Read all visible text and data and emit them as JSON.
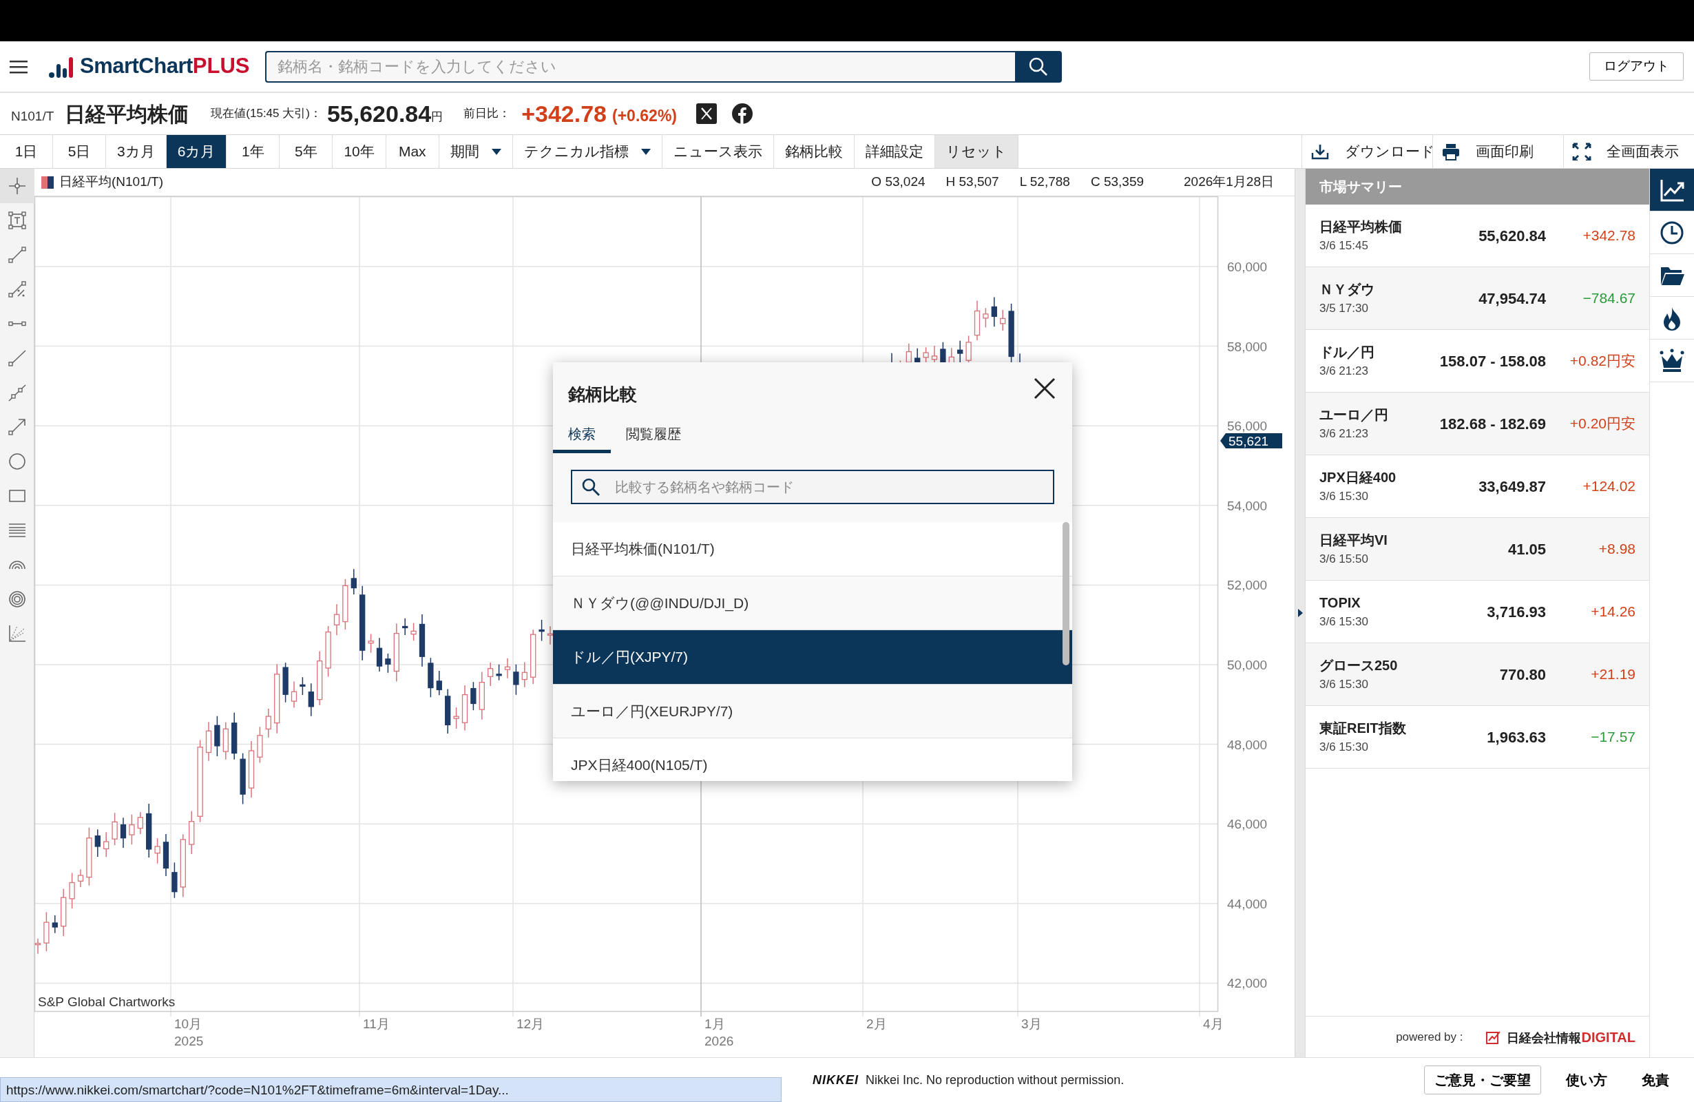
{
  "header": {
    "logo": {
      "main": "SmartChart",
      "accent": "PLUS"
    },
    "search": {
      "placeholder": "銘柄名・銘柄コードを入力してください"
    },
    "logout": "ログアウト"
  },
  "quote": {
    "code": "N101/T",
    "name": "日経平均株価",
    "price_label": "現在値(15:45 大引)：",
    "price": "55,620.84",
    "unit": "円",
    "change_label": "前日比：",
    "change": "+342.78",
    "change_pct": "(+0.62%)"
  },
  "toolbar": {
    "periods": [
      {
        "label": "1日",
        "selected": false
      },
      {
        "label": "5日",
        "selected": false
      },
      {
        "label": "3カ月",
        "selected": false
      },
      {
        "label": "6カ月",
        "selected": true
      },
      {
        "label": "1年",
        "selected": false
      },
      {
        "label": "5年",
        "selected": false
      },
      {
        "label": "10年",
        "selected": false
      },
      {
        "label": "Max",
        "selected": false
      }
    ],
    "menus": [
      {
        "label": "期間",
        "kind": "dropdown"
      },
      {
        "label": "テクニカル指標",
        "kind": "dropdown"
      },
      {
        "label": "ニュース表示",
        "kind": "plain"
      },
      {
        "label": "銘柄比較",
        "kind": "plain"
      },
      {
        "label": "詳細設定",
        "kind": "plain"
      },
      {
        "label": "リセット",
        "kind": "reset"
      }
    ],
    "actions": [
      {
        "label": "ダウンロード",
        "kind": "download"
      },
      {
        "label": "画面印刷",
        "kind": "print"
      },
      {
        "label": "全画面表示",
        "kind": "fullscreen"
      }
    ]
  },
  "drawing_tools": [
    {
      "kind": "crosshair",
      "selected": true
    },
    {
      "kind": "textbox",
      "selected": false
    },
    {
      "kind": "segment",
      "selected": false
    },
    {
      "kind": "percent",
      "selected": false
    },
    {
      "kind": "hsegment",
      "selected": false
    },
    {
      "kind": "ray",
      "selected": false
    },
    {
      "kind": "polyline",
      "selected": false
    },
    {
      "kind": "arrow",
      "selected": false
    },
    {
      "kind": "circle",
      "selected": false
    },
    {
      "kind": "rect",
      "selected": false
    },
    {
      "kind": "lines",
      "selected": false
    },
    {
      "kind": "arcs",
      "selected": false
    },
    {
      "kind": "rings",
      "selected": false
    },
    {
      "kind": "fan",
      "selected": false
    }
  ],
  "chart": {
    "legend": "日経平均(N101/T)",
    "ohlc": [
      "O 53,024",
      "H 53,507",
      "L 52,788",
      "C 53,359"
    ],
    "date": "2026年1月28日",
    "y_labels": [
      "60,000",
      "58,000",
      "56,000",
      "54,000",
      "52,000",
      "50,000",
      "48,000",
      "46,000",
      "44,000",
      "42,000"
    ],
    "price_tag": "55,621",
    "x_labels": [
      {
        "month": "10月",
        "year": "2025"
      },
      {
        "month": "11月"
      },
      {
        "month": "12月"
      },
      {
        "month": "1月",
        "year": "2026"
      },
      {
        "month": "2月"
      },
      {
        "month": "3月"
      },
      {
        "month": "4月"
      }
    ],
    "credit": "S&P Global Chartworks"
  },
  "compare_dialog": {
    "title": "銘柄比較",
    "tabs": [
      {
        "label": "検索",
        "selected": true
      },
      {
        "label": "閲覧履歴",
        "selected": false
      }
    ],
    "search": {
      "placeholder": "比較する銘柄名や銘柄コード"
    },
    "results": [
      {
        "label": "日経平均株価(N101/T)",
        "selected": false
      },
      {
        "label": "ＮＹダウ(@@INDU/DJI_D)",
        "selected": false
      },
      {
        "label": "ドル／円(XJPY/7)",
        "selected": true
      },
      {
        "label": "ユーロ／円(XEURJPY/7)",
        "selected": false
      },
      {
        "label": "JPX日経400(N105/T)",
        "selected": false
      }
    ]
  },
  "market_summary": {
    "title": "市場サマリー",
    "rows": [
      {
        "name": "日経平均株価",
        "time": "3/6 15:45",
        "value": "55,620.84",
        "change": "+342.78",
        "color": "#d2401a"
      },
      {
        "name": "ＮＹダウ",
        "time": "3/5 17:30",
        "value": "47,954.74",
        "change": "−784.67",
        "color": "#2a9a3a"
      },
      {
        "name": "ドル／円",
        "time": "3/6 21:23",
        "value": "158.07 - 158.08",
        "change": "+0.82円安",
        "color": "#d2401a"
      },
      {
        "name": "ユーロ／円",
        "time": "3/6 21:23",
        "value": "182.68 - 182.69",
        "change": "+0.20円安",
        "color": "#d2401a"
      },
      {
        "name": "JPX日経400",
        "time": "3/6 15:30",
        "value": "33,649.87",
        "change": "+124.02",
        "color": "#d2401a"
      },
      {
        "name": "日経平均VI",
        "time": "3/6 15:50",
        "value": "41.05",
        "change": "+8.98",
        "color": "#d2401a"
      },
      {
        "name": "TOPIX",
        "time": "3/6 15:30",
        "value": "3,716.93",
        "change": "+14.26",
        "color": "#d2401a"
      },
      {
        "name": "グロース250",
        "time": "3/6 15:30",
        "value": "770.80",
        "change": "+21.19",
        "color": "#d2401a"
      },
      {
        "name": "東証REIT指数",
        "time": "3/6 15:30",
        "value": "1,963.63",
        "change": "−17.57",
        "color": "#2a9a3a"
      }
    ],
    "powered_by": "powered by :",
    "brand": "日経会社情報",
    "brand_accent": "DIGITAL"
  },
  "side_tabs": [
    {
      "kind": "trend",
      "selected": true
    },
    {
      "kind": "clock",
      "selected": false
    },
    {
      "kind": "folder",
      "selected": false
    },
    {
      "kind": "flame",
      "selected": false
    },
    {
      "kind": "crown",
      "selected": false
    }
  ],
  "footer": {
    "logo": "NIKKEI",
    "copyright": "Nikkei Inc. No reproduction without permission.",
    "links": [
      {
        "label": "ご意見・ご要望",
        "kind": "outlined"
      },
      {
        "label": "使い方",
        "kind": "plain"
      },
      {
        "label": "免責",
        "kind": "plain"
      }
    ]
  },
  "status_url": "https://www.nikkei.com/smartchart/?code=N101%2FT&timeframe=6m&interval=1Day..."
}
